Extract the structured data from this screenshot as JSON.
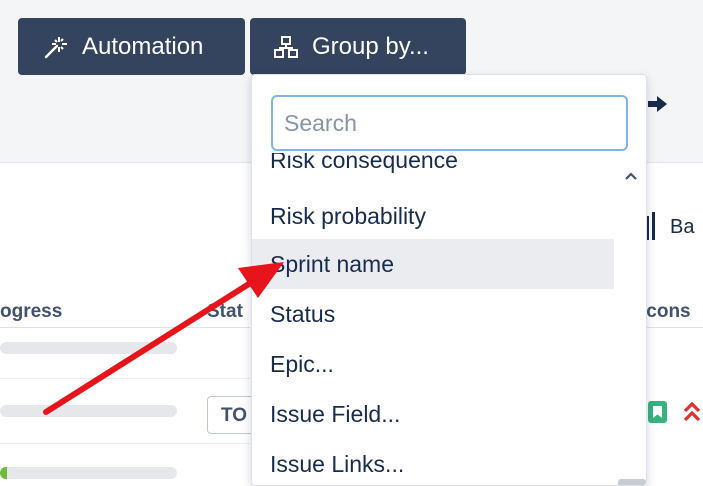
{
  "toolbar": {
    "automation_label": "Automation",
    "group_by_label": "Group by..."
  },
  "background": {
    "bas_text": "Ba",
    "columns": {
      "progress": "ogress",
      "status": "Stat",
      "icons": "Icons"
    },
    "status_lozenge": "TO",
    "progress_rows": [
      0,
      0,
      0.04
    ]
  },
  "dropdown": {
    "search_placeholder": "Search",
    "items": [
      "Risk consequence",
      "Risk probability",
      "Sprint name",
      "Status",
      "Epic...",
      "Issue Field...",
      "Issue Links..."
    ],
    "hovered_item": "Sprint name"
  },
  "icons": {
    "automation": "magic-wand-icon",
    "group_by": "hierarchy-icon",
    "export": "arrow-right-icon",
    "story": "bookmark-icon",
    "priority": "double-chevron-up-icon",
    "scroll_up": "chevron-up-icon"
  },
  "colors": {
    "toolbar_button": "#34435e",
    "annotation_arrow": "#e8141c",
    "search_border": "#7fb5e8",
    "story_green": "#36b37e",
    "priority_red": "#e5312c",
    "progress_green": "#6ebc3b"
  }
}
